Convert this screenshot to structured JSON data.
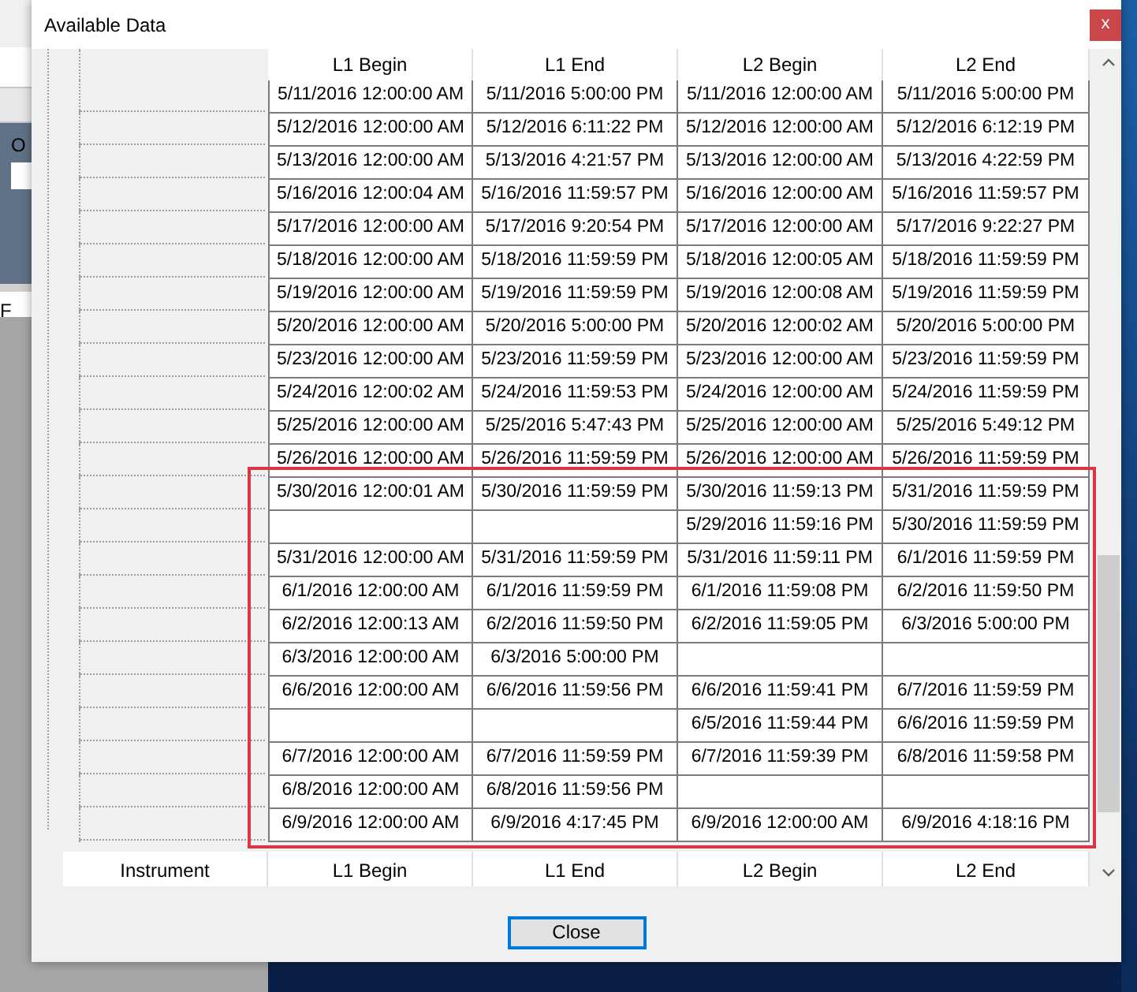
{
  "background_window": {
    "labels": [
      "O",
      "F"
    ]
  },
  "window": {
    "title": "Available Data",
    "close_glyph": "x"
  },
  "table": {
    "columns": [
      "L1 Begin",
      "L1 End",
      "L2 Begin",
      "L2 End"
    ],
    "rows": [
      [
        "5/11/2016 12:00:00 AM",
        "5/11/2016 5:00:00 PM",
        "5/11/2016 12:00:00 AM",
        "5/11/2016 5:00:00 PM"
      ],
      [
        "5/12/2016 12:00:00 AM",
        "5/12/2016 6:11:22 PM",
        "5/12/2016 12:00:00 AM",
        "5/12/2016 6:12:19 PM"
      ],
      [
        "5/13/2016 12:00:00 AM",
        "5/13/2016 4:21:57 PM",
        "5/13/2016 12:00:00 AM",
        "5/13/2016 4:22:59 PM"
      ],
      [
        "5/16/2016 12:00:04 AM",
        "5/16/2016 11:59:57 PM",
        "5/16/2016 12:00:00 AM",
        "5/16/2016 11:59:57 PM"
      ],
      [
        "5/17/2016 12:00:00 AM",
        "5/17/2016 9:20:54 PM",
        "5/17/2016 12:00:00 AM",
        "5/17/2016 9:22:27 PM"
      ],
      [
        "5/18/2016 12:00:00 AM",
        "5/18/2016 11:59:59 PM",
        "5/18/2016 12:00:05 AM",
        "5/18/2016 11:59:59 PM"
      ],
      [
        "5/19/2016 12:00:00 AM",
        "5/19/2016 11:59:59 PM",
        "5/19/2016 12:00:08 AM",
        "5/19/2016 11:59:59 PM"
      ],
      [
        "5/20/2016 12:00:00 AM",
        "5/20/2016 5:00:00 PM",
        "5/20/2016 12:00:02 AM",
        "5/20/2016 5:00:00 PM"
      ],
      [
        "5/23/2016 12:00:00 AM",
        "5/23/2016 11:59:59 PM",
        "5/23/2016 12:00:00 AM",
        "5/23/2016 11:59:59 PM"
      ],
      [
        "5/24/2016 12:00:02 AM",
        "5/24/2016 11:59:53 PM",
        "5/24/2016 12:00:00 AM",
        "5/24/2016 11:59:59 PM"
      ],
      [
        "5/25/2016 12:00:00 AM",
        "5/25/2016 5:47:43 PM",
        "5/25/2016 12:00:00 AM",
        "5/25/2016 5:49:12 PM"
      ],
      [
        "5/26/2016 12:00:00 AM",
        "5/26/2016 11:59:59 PM",
        "5/26/2016 12:00:00 AM",
        "5/26/2016 11:59:59 PM"
      ],
      [
        "5/30/2016 12:00:01 AM",
        "5/30/2016 11:59:59 PM",
        "5/30/2016 11:59:13 PM",
        "5/31/2016 11:59:59 PM"
      ],
      [
        null,
        null,
        "5/29/2016 11:59:16 PM",
        "5/30/2016 11:59:59 PM"
      ],
      [
        "5/31/2016 12:00:00 AM",
        "5/31/2016 11:59:59 PM",
        "5/31/2016 11:59:11 PM",
        "6/1/2016 11:59:59 PM"
      ],
      [
        "6/1/2016 12:00:00 AM",
        "6/1/2016 11:59:59 PM",
        "6/1/2016 11:59:08 PM",
        "6/2/2016 11:59:50 PM"
      ],
      [
        "6/2/2016 12:00:13 AM",
        "6/2/2016 11:59:50 PM",
        "6/2/2016 11:59:05 PM",
        "6/3/2016 5:00:00 PM"
      ],
      [
        "6/3/2016 12:00:00 AM",
        "6/3/2016 5:00:00 PM",
        null,
        null
      ],
      [
        "6/6/2016 12:00:00 AM",
        "6/6/2016 11:59:56 PM",
        "6/6/2016 11:59:41 PM",
        "6/7/2016 11:59:59 PM"
      ],
      [
        null,
        null,
        "6/5/2016 11:59:44 PM",
        "6/6/2016 11:59:59 PM"
      ],
      [
        "6/7/2016 12:00:00 AM",
        "6/7/2016 11:59:59 PM",
        "6/7/2016 11:59:39 PM",
        "6/8/2016 11:59:58 PM"
      ],
      [
        "6/8/2016 12:00:00 AM",
        "6/8/2016 11:59:56 PM",
        null,
        null
      ],
      [
        "6/9/2016 12:00:00 AM",
        "6/9/2016 4:17:45 PM",
        "6/9/2016 12:00:00 AM",
        "6/9/2016 4:18:16 PM"
      ]
    ],
    "footer_columns": [
      "Instrument",
      "L1 Begin",
      "L1 End",
      "L2 Begin",
      "L2 End"
    ]
  },
  "buttons": [
    "Close"
  ]
}
